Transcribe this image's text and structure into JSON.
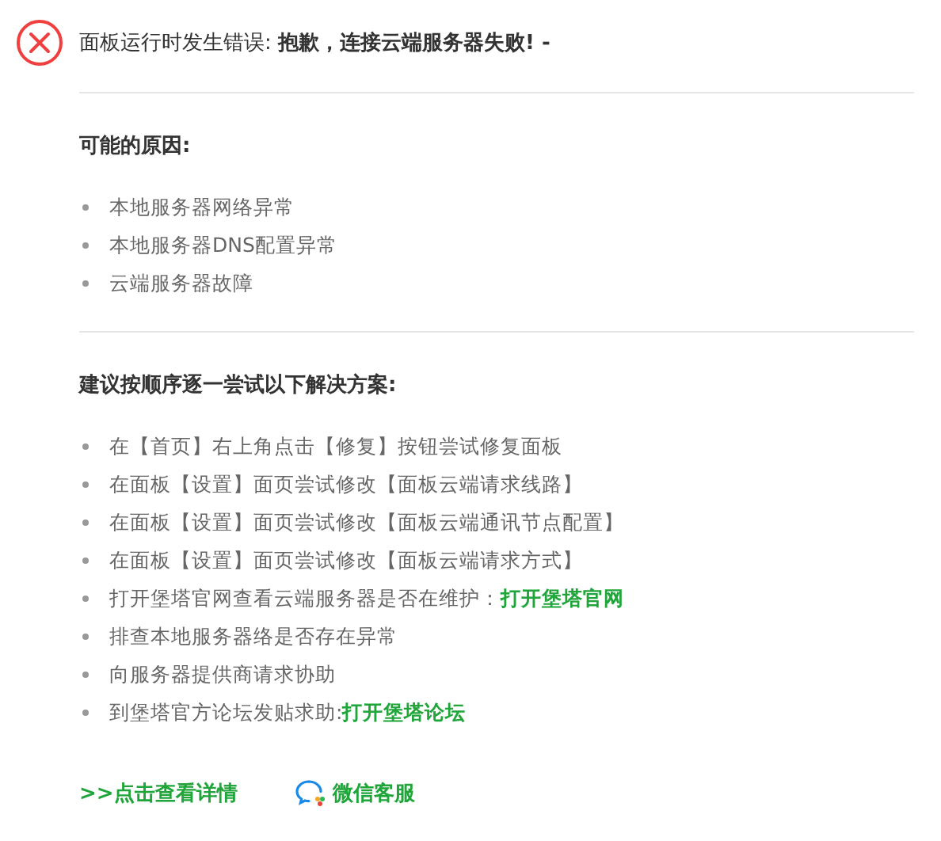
{
  "title": "面板运行时发生错误: **抱歉，连接云端服务器失败! -**",
  "causes": {
    "heading": "可能的原因:",
    "items": [
      {
        "text": "本地服务器网络异常"
      },
      {
        "text": "本地服务器DNS配置异常"
      },
      {
        "text": "云端服务器故障"
      }
    ]
  },
  "solutions": {
    "heading": "建议按顺序逐一尝试以下解决方案:",
    "items": [
      {
        "text": "在【首页】右上角点击【修复】按钮尝试修复面板"
      },
      {
        "text": "在面板【设置】面页尝试修改【面板云端请求线路】"
      },
      {
        "text": "在面板【设置】面页尝试修改【面板云端通讯节点配置】"
      },
      {
        "text": "在面板【设置】面页尝试修改【面板云端请求方式】"
      },
      {
        "text": "打开堡塔官网查看云端服务器是否在维护：",
        "link": "打开堡塔官网"
      },
      {
        "text": "排查本地服务器络是否存在异常"
      },
      {
        "text": "向服务器提供商请求协助"
      },
      {
        "text": "到堡塔官方论坛发贴求助: ",
        "link": "打开堡塔论坛"
      }
    ]
  },
  "footer": {
    "details_link": ">>点击查看详情",
    "support_link": "微信客服"
  }
}
